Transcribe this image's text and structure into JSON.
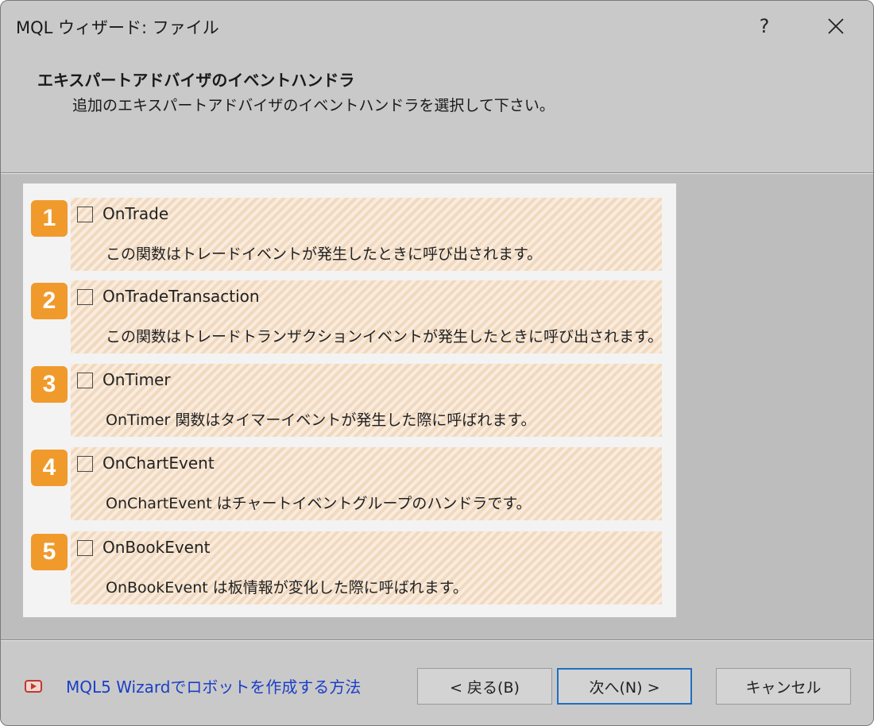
{
  "window": {
    "title": "MQL ウィザード: ファイル",
    "help_glyph": "?",
    "close_glyph": "✕"
  },
  "header": {
    "heading": "エキスパートアドバイザのイベントハンドラ",
    "subheading": "追加のエキスパートアドバイザのイベントハンドラを選択して下さい。"
  },
  "handlers": [
    {
      "number": "1",
      "name": "OnTrade",
      "description": "この関数はトレードイベントが発生したときに呼び出されます。",
      "checked": false
    },
    {
      "number": "2",
      "name": "OnTradeTransaction",
      "description": "この関数はトレードトランザクションイベントが発生したときに呼び出されます。",
      "checked": false
    },
    {
      "number": "3",
      "name": "OnTimer",
      "description": "OnTimer 関数はタイマーイベントが発生した際に呼ばれます。",
      "checked": false
    },
    {
      "number": "4",
      "name": "OnChartEvent",
      "description": "OnChartEvent はチャートイベントグループのハンドラです。",
      "checked": false
    },
    {
      "number": "5",
      "name": "OnBookEvent",
      "description": "OnBookEvent は板情報が変化した際に呼ばれます。",
      "checked": false
    }
  ],
  "footer": {
    "help_link": "MQL5 Wizardでロボットを作成する方法",
    "help_icon": "video-play-icon",
    "back_label": "< 戻る(B)",
    "next_label": "次へ(N) >",
    "cancel_label": "キャンセル"
  },
  "colors": {
    "badge": "#f09a2c",
    "item_background": "#f6e2cc",
    "link": "#1a3fc7",
    "default_button_border": "#1f6fc1"
  }
}
